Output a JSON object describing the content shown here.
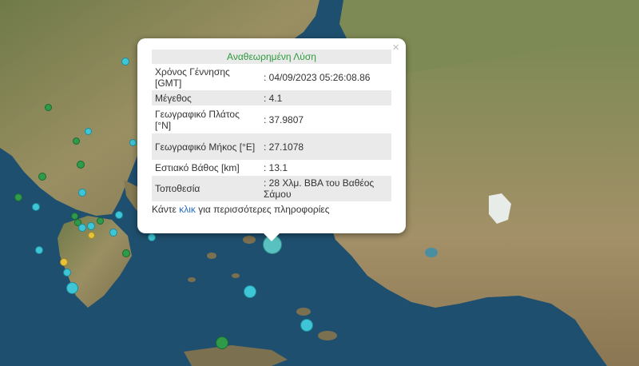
{
  "popup": {
    "title": "Αναθεωρημένη Λύση",
    "close": "×",
    "rows": [
      {
        "label": "Χρόνος Γέννησης [GMT]",
        "value": ": 04/09/2023 05:26:08.86"
      },
      {
        "label": "Μέγεθος",
        "value": ": 4.1"
      },
      {
        "label": "Γεωγραφικό Πλάτος [°N]",
        "value": ": 37.9807"
      },
      {
        "label": "Γεωγραφικό Μήκος [°E]",
        "value": ": 27.1078"
      },
      {
        "label": "Εστιακό Βάθος [km]",
        "value": ": 13.1"
      },
      {
        "label": "Τοποθεσία",
        "value": ": 28 Χλμ. ΒΒΑ του Βαθέος Σάμου"
      }
    ],
    "footer_before": "Κάντε ",
    "footer_link": "κλικ",
    "footer_after": " για περισσότερες πληροφορίες"
  },
  "colors": {
    "sea": "#1f4f6e",
    "land": "#8a8a5a",
    "title_green": "#2e9a3e",
    "link_blue": "#2b6cc4"
  }
}
